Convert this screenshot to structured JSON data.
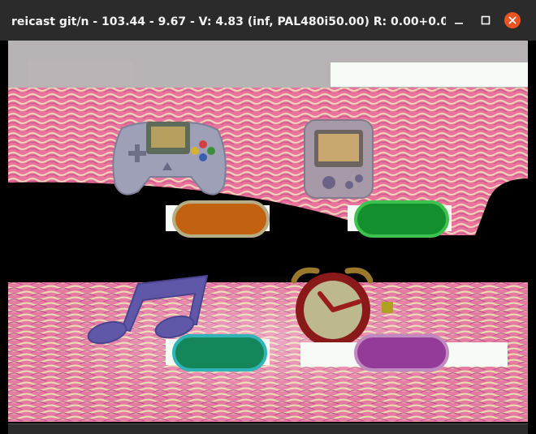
{
  "window": {
    "title": "reicast git/n - 103.44 - 9.67 - V: 4.83 (inf, PAL480i50.00) R: 0.00+0.00 VTX: 0.",
    "title_ellipsis": "...",
    "controls": {
      "minimize_icon": "minimize-icon",
      "maximize_icon": "maximize-icon",
      "close_icon": "close-icon"
    }
  },
  "emulator_screen": {
    "menu_tiles": [
      {
        "name": "controller",
        "icon": "gamepad-icon",
        "button_color": "#d4680f"
      },
      {
        "name": "vmu",
        "icon": "memory-card-icon",
        "button_color": "#148f2e"
      },
      {
        "name": "music",
        "icon": "music-note-icon",
        "button_color": "#14865a"
      },
      {
        "name": "clock",
        "icon": "alarm-clock-icon",
        "button_color": "#9a3d95"
      }
    ],
    "colors": {
      "glitch_pink": "#e8739c",
      "glitch_yellow": "#e8d6a0",
      "top_bar": "#b7b2b4",
      "white_patch": "#f6fbf6"
    }
  }
}
